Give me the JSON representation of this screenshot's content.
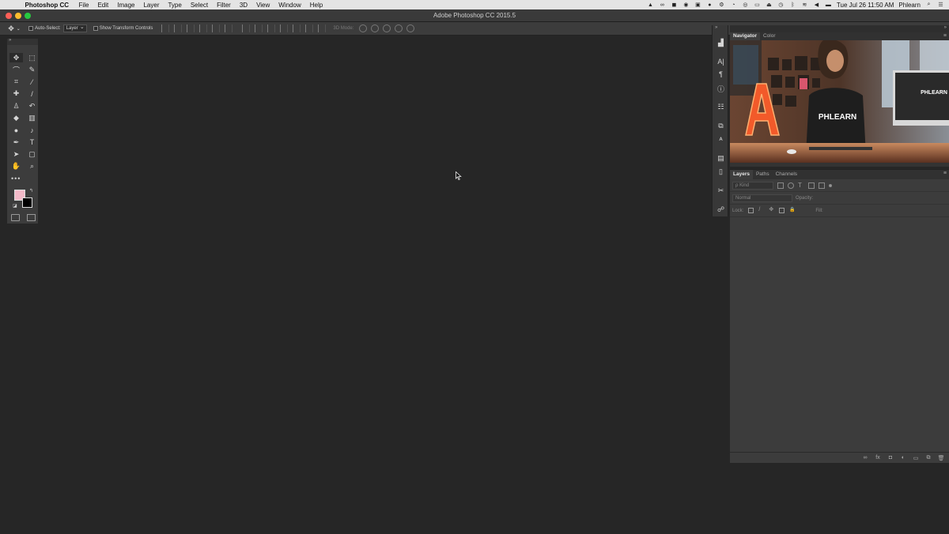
{
  "menubar": {
    "app_name": "Photoshop CC",
    "items": [
      "File",
      "Edit",
      "Image",
      "Layer",
      "Type",
      "Select",
      "Filter",
      "3D",
      "View",
      "Window",
      "Help"
    ],
    "clock": "Tue Jul 26  11:50 AM",
    "user": "Phlearn"
  },
  "window": {
    "title": "Adobe Photoshop CC 2015.5"
  },
  "options_bar": {
    "auto_select_label": "Auto-Select:",
    "auto_select_value": "Layer",
    "transform_label": "Show Transform Controls",
    "mode3d_label": "3D Mode:"
  },
  "navigator": {
    "tabs": [
      "Navigator",
      "Color"
    ],
    "active_tab": "Navigator",
    "preview_shirt_text": "PHLEARN",
    "preview_monitor_text": "PHLEARN"
  },
  "layers": {
    "tabs": [
      "Layers",
      "Paths",
      "Channels"
    ],
    "active_tab": "Layers",
    "filter_placeholder": "ρ Kind",
    "blend_mode": "Normal",
    "opacity_label": "Opacity:",
    "lock_label": "Lock:",
    "fill_label": "Fill:"
  },
  "colors": {
    "foreground": "#f2b9c8",
    "background": "#000000",
    "workspace": "#262626"
  }
}
